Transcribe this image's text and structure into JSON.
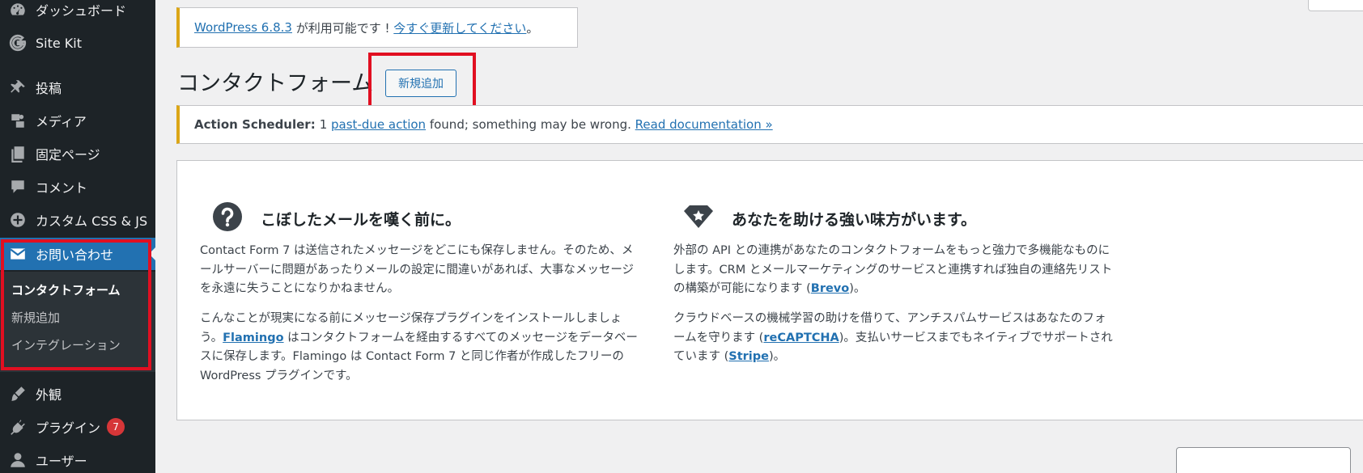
{
  "sidebar": {
    "items": [
      {
        "label": "ダッシュボード",
        "icon": "dashboard-icon"
      },
      {
        "label": "Site Kit",
        "icon": "google-g-icon"
      },
      {
        "label": "投稿",
        "icon": "pushpin-icon"
      },
      {
        "label": "メディア",
        "icon": "media-icon"
      },
      {
        "label": "固定ページ",
        "icon": "pages-icon"
      },
      {
        "label": "コメント",
        "icon": "comment-icon"
      },
      {
        "label": "カスタム CSS & JS",
        "icon": "plus-circle-icon"
      },
      {
        "label": "お問い合わせ",
        "icon": "envelope-icon"
      },
      {
        "label": "外観",
        "icon": "paintbrush-icon"
      },
      {
        "label": "プラグイン",
        "icon": "plugin-icon",
        "badge": "7"
      },
      {
        "label": "ユーザー",
        "icon": "user-icon"
      }
    ],
    "submenu": [
      "コンタクトフォーム",
      "新規追加",
      "インテグレーション"
    ]
  },
  "update_notice": {
    "link_version": "WordPress 6.8.3",
    "text": " が利用可能です ! ",
    "link_update": "今すぐ更新してください",
    "suffix": "。"
  },
  "page": {
    "title": "コンタクトフォーム",
    "add_new": "新規追加"
  },
  "action_notice": {
    "label": "Action Scheduler:",
    "count": "1",
    "link_past_due": "past-due action",
    "text": "found; something may be wrong.",
    "link_docs": "Read documentation »"
  },
  "promo": {
    "left": {
      "icon": "question-icon",
      "heading": "こぼしたメールを嘆く前に。",
      "p1": "Contact Form 7 は送信されたメッセージをどこにも保存しません。そのため、メールサーバーに問題があったりメールの設定に間違いがあれば、大事なメッセージを永遠に失うことになりかねません。",
      "p2_a": "こんなことが現実になる前にメッセージ保存プラグインをインストールしましょう。",
      "p2_link": "Flamingo",
      "p2_b": " はコンタクトフォームを経由するすべてのメッセージをデータベースに保存します。Flamingo は Contact Form 7 と同じ作者が作成したフリーの WordPress プラグインです。"
    },
    "right": {
      "icon": "diamond-star-icon",
      "heading": "あなたを助ける強い味方がいます。",
      "p1_a": "外部の API との連携があなたのコンタクトフォームをもっと強力で多機能なものにします。CRM とメールマーケティングのサービスと連携すれば独自の連絡先リストの構築が可能になります (",
      "p1_link": "Brevo",
      "p1_b": ")。",
      "p2_a": "クラウドベースの機械学習の助けを借りて、アンチスパムサービスはあなたのフォームを守ります (",
      "p2_link1": "reCAPTCHA",
      "p2_b": ")。支払いサービスまでもネイティブでサポートされています (",
      "p2_link2": "Stripe",
      "p2_c": ")。"
    }
  },
  "colors": {
    "sidebar_bg": "#1d2327",
    "active_blue": "#2271b1",
    "notice_yellow": "#dba617",
    "highlight_red": "#e10f21",
    "badge_red": "#d63638"
  }
}
